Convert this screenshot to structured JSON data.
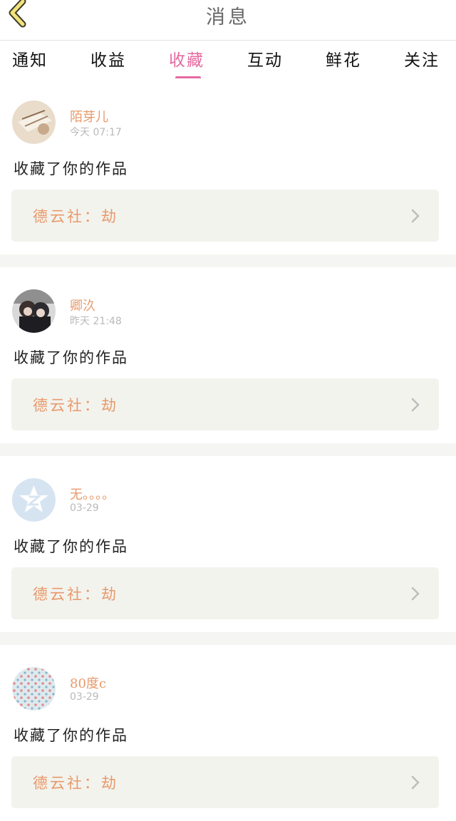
{
  "header": {
    "title": "消息",
    "back_icon": "chevron-left-icon"
  },
  "tabs": [
    {
      "label": "通知",
      "active": false
    },
    {
      "label": "收益",
      "active": false
    },
    {
      "label": "收藏",
      "active": true
    },
    {
      "label": "互动",
      "active": false
    },
    {
      "label": "鲜花",
      "active": false
    },
    {
      "label": "关注",
      "active": false
    }
  ],
  "colors": {
    "accent": "#e56aa0",
    "name": "#e79a6b",
    "card_bg": "#f3f3ee",
    "separator": "#f5f5f3"
  },
  "messages": [
    {
      "name": "陌芽儿",
      "time": "今天 07:17",
      "action": "收藏了你的作品",
      "work": "德云社：劫",
      "avatar": "photo-avatar"
    },
    {
      "name": "卿汣",
      "time": "昨天 21:48",
      "action": "收藏了你的作品",
      "work": "德云社：劫",
      "avatar": "photo-avatar"
    },
    {
      "name": "无。。。。",
      "time": "03-29",
      "action": "收藏了你的作品",
      "work": "德云社：劫",
      "avatar": "default-qq-avatar"
    },
    {
      "name": "80度c",
      "time": "03-29",
      "action": "收藏了你的作品",
      "work": "德云社：劫",
      "avatar": "pattern-avatar"
    }
  ]
}
